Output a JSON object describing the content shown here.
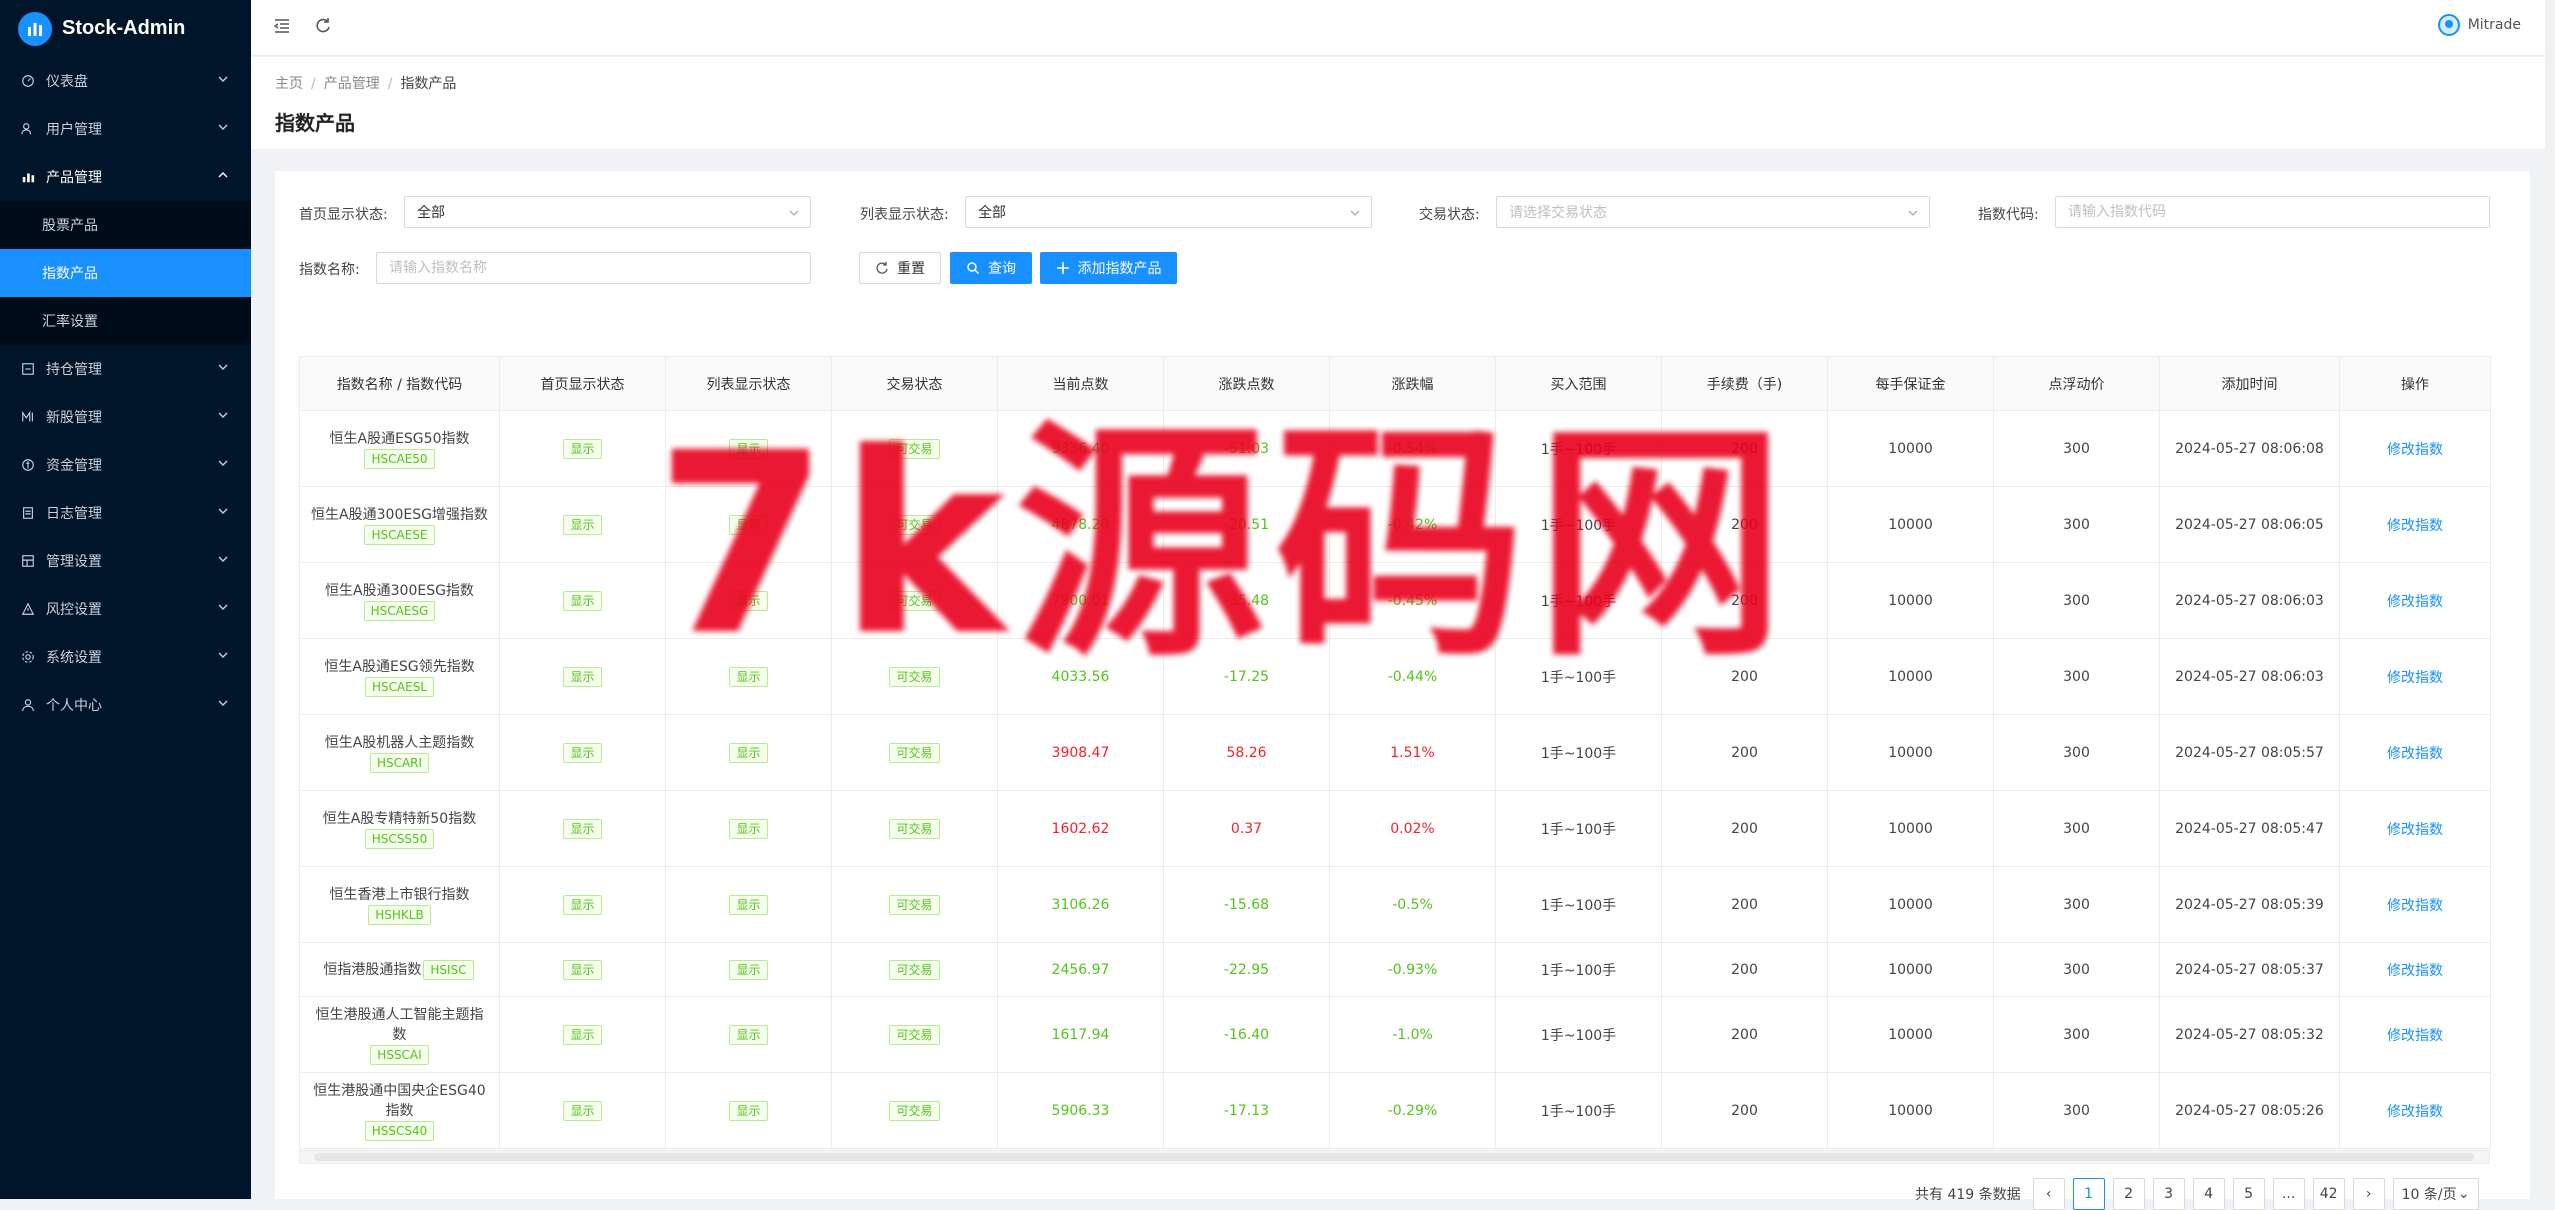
{
  "app": {
    "name": "Stock-Admin",
    "user": "Mitrade"
  },
  "sidebar": {
    "items": [
      {
        "label": "仪表盘",
        "icon": "dashboard-icon"
      },
      {
        "label": "用户管理",
        "icon": "users-icon"
      },
      {
        "label": "产品管理",
        "icon": "chart-icon",
        "open": true,
        "children": [
          {
            "label": "股票产品"
          },
          {
            "label": "指数产品",
            "active": true
          },
          {
            "label": "汇率设置"
          }
        ]
      },
      {
        "label": "持仓管理",
        "icon": "position-icon"
      },
      {
        "label": "新股管理",
        "icon": "ipo-icon"
      },
      {
        "label": "资金管理",
        "icon": "funds-icon"
      },
      {
        "label": "日志管理",
        "icon": "log-icon"
      },
      {
        "label": "管理设置",
        "icon": "admin-icon"
      },
      {
        "label": "风控设置",
        "icon": "risk-icon"
      },
      {
        "label": "系统设置",
        "icon": "gear-icon"
      },
      {
        "label": "个人中心",
        "icon": "person-icon"
      }
    ]
  },
  "breadcrumb": [
    "主页",
    "产品管理",
    "指数产品"
  ],
  "page_title": "指数产品",
  "filters": {
    "home_status": {
      "label": "首页显示状态:",
      "value": "全部"
    },
    "list_status": {
      "label": "列表显示状态:",
      "value": "全部"
    },
    "trade_status": {
      "label": "交易状态:",
      "placeholder": "请选择交易状态"
    },
    "index_code": {
      "label": "指数代码:",
      "placeholder": "请输入指数代码"
    },
    "index_name": {
      "label": "指数名称:",
      "placeholder": "请输入指数名称"
    },
    "reset": "重置",
    "query": "查询",
    "add": "添加指数产品"
  },
  "table": {
    "columns": [
      "指数名称 / 指数代码",
      "首页显示状态",
      "列表显示状态",
      "交易状态",
      "当前点数",
      "涨跌点数",
      "涨跌幅",
      "买入范围",
      "手续费（手)",
      "每手保证金",
      "点浮动价",
      "添加时间",
      "操作"
    ],
    "rows": [
      {
        "name": "恒生A股通ESG50指数",
        "code": "HSCAE50",
        "home": "显示",
        "list": "显示",
        "trade": "可交易",
        "price": "9336.40",
        "change": "-51.03",
        "pct": "-0.54%",
        "dir": "down",
        "range": "1手~100手",
        "fee": "200",
        "margin": "10000",
        "float": "300",
        "time": "2024-05-27 08:06:08",
        "action": "修改指数"
      },
      {
        "name": "恒生A股通300ESG增强指数",
        "code": "HSCAESE",
        "home": "显示",
        "list": "显示",
        "trade": "可交易",
        "price": "4878.20",
        "change": "-20.51",
        "pct": "-0.42%",
        "dir": "down",
        "range": "1手~100手",
        "fee": "200",
        "margin": "10000",
        "float": "300",
        "time": "2024-05-27 08:06:05",
        "action": "修改指数"
      },
      {
        "name": "恒生A股通300ESG指数",
        "code": "HSCAESG",
        "home": "显示",
        "list": "显示",
        "trade": "可交易",
        "price": "7900.01",
        "change": "-35.48",
        "pct": "-0.45%",
        "dir": "down",
        "range": "1手~100手",
        "fee": "200",
        "margin": "10000",
        "float": "300",
        "time": "2024-05-27 08:06:03",
        "action": "修改指数"
      },
      {
        "name": "恒生A股通ESG领先指数",
        "code": "HSCAESL",
        "home": "显示",
        "list": "显示",
        "trade": "可交易",
        "price": "4033.56",
        "change": "-17.25",
        "pct": "-0.44%",
        "dir": "down",
        "range": "1手~100手",
        "fee": "200",
        "margin": "10000",
        "float": "300",
        "time": "2024-05-27 08:06:03",
        "action": "修改指数"
      },
      {
        "name": "恒生A股机器人主题指数",
        "code": "HSCARI",
        "home": "显示",
        "list": "显示",
        "trade": "可交易",
        "price": "3908.47",
        "change": "58.26",
        "pct": "1.51%",
        "dir": "up",
        "range": "1手~100手",
        "fee": "200",
        "margin": "10000",
        "float": "300",
        "time": "2024-05-27 08:05:57",
        "action": "修改指数"
      },
      {
        "name": "恒生A股专精特新50指数",
        "code": "HSCSS50",
        "home": "显示",
        "list": "显示",
        "trade": "可交易",
        "price": "1602.62",
        "change": "0.37",
        "pct": "0.02%",
        "dir": "up",
        "range": "1手~100手",
        "fee": "200",
        "margin": "10000",
        "float": "300",
        "time": "2024-05-27 08:05:47",
        "action": "修改指数"
      },
      {
        "name": "恒生香港上市银行指数",
        "code": "HSHKLB",
        "home": "显示",
        "list": "显示",
        "trade": "可交易",
        "price": "3106.26",
        "change": "-15.68",
        "pct": "-0.5%",
        "dir": "down",
        "range": "1手~100手",
        "fee": "200",
        "margin": "10000",
        "float": "300",
        "time": "2024-05-27 08:05:39",
        "action": "修改指数"
      },
      {
        "name": "恒指港股通指数",
        "code": "HSISC",
        "home": "显示",
        "list": "显示",
        "trade": "可交易",
        "price": "2456.97",
        "change": "-22.95",
        "pct": "-0.93%",
        "dir": "down",
        "range": "1手~100手",
        "fee": "200",
        "margin": "10000",
        "float": "300",
        "time": "2024-05-27 08:05:37",
        "action": "修改指数",
        "inline": true
      },
      {
        "name": "恒生港股通人工智能主题指数",
        "code": "HSSCAI",
        "home": "显示",
        "list": "显示",
        "trade": "可交易",
        "price": "1617.94",
        "change": "-16.40",
        "pct": "-1.0%",
        "dir": "down",
        "range": "1手~100手",
        "fee": "200",
        "margin": "10000",
        "float": "300",
        "time": "2024-05-27 08:05:32",
        "action": "修改指数"
      },
      {
        "name": "恒生港股通中国央企ESG40指数",
        "code": "HSSCS40",
        "home": "显示",
        "list": "显示",
        "trade": "可交易",
        "price": "5906.33",
        "change": "-17.13",
        "pct": "-0.29%",
        "dir": "down",
        "range": "1手~100手",
        "fee": "200",
        "margin": "10000",
        "float": "300",
        "time": "2024-05-27 08:05:26",
        "action": "修改指数"
      }
    ]
  },
  "pagination": {
    "total_text": "共有 419 条数据",
    "pages": [
      "1",
      "2",
      "3",
      "4",
      "5",
      "...",
      "42"
    ],
    "current": "1",
    "page_size": "10 条/页"
  },
  "watermark": "7k源码网",
  "colors": {
    "primary": "#1890ff",
    "up": "#f5222d",
    "down": "#52c41a",
    "sidebar": "#001529"
  }
}
